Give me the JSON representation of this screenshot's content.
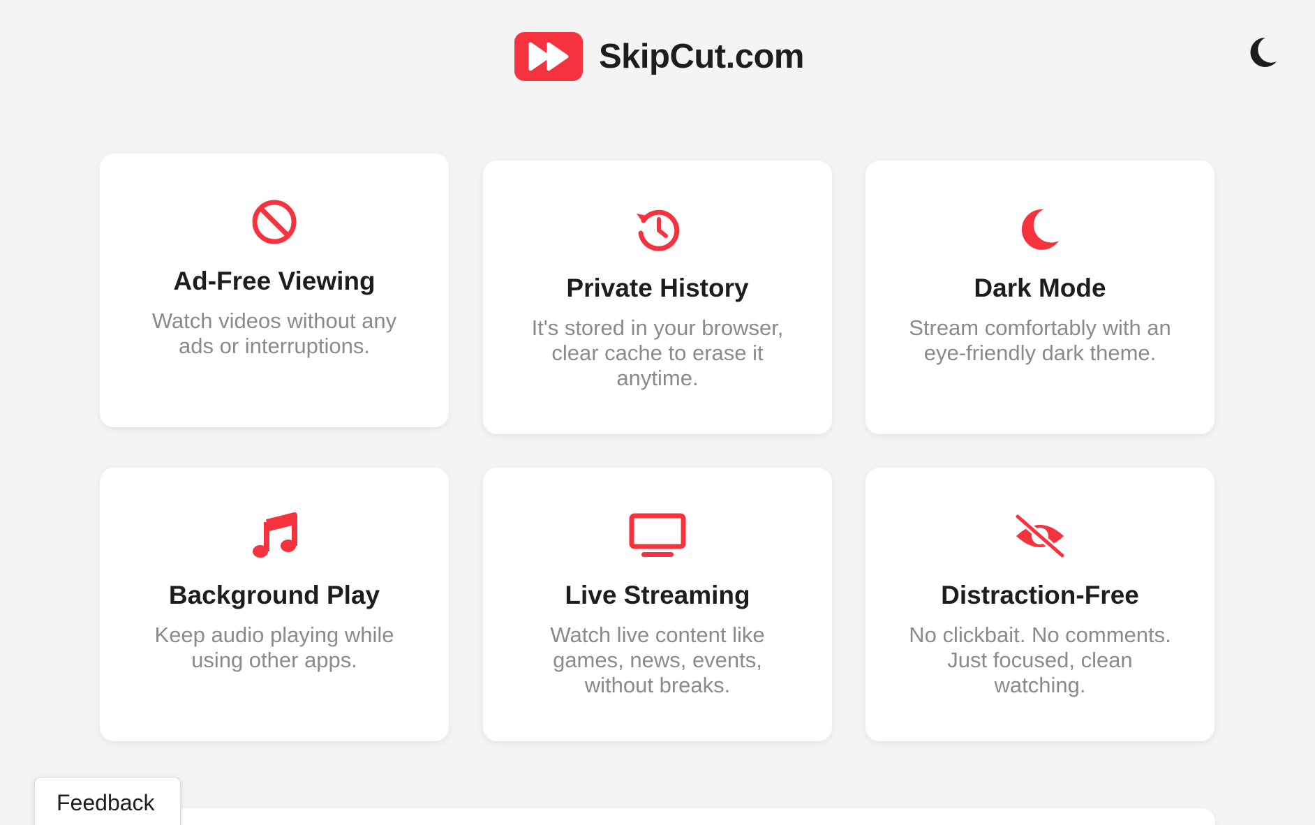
{
  "header": {
    "brand_name": "SkipCut.com",
    "logo_icon": "fast-forward-icon",
    "theme_toggle_icon": "moon-icon"
  },
  "colors": {
    "accent": "#f5333f",
    "background": "#f4f4f6",
    "card": "#ffffff",
    "title_text": "#1d1d1f",
    "body_text": "#8a8a8e"
  },
  "features": [
    {
      "icon": "no-ads-icon",
      "title": "Ad-Free Viewing",
      "description": "Watch videos without any ads or interruptions."
    },
    {
      "icon": "history-icon",
      "title": "Private History",
      "description": "It's stored in your browser, clear cache to erase it anytime."
    },
    {
      "icon": "moon-icon",
      "title": "Dark Mode",
      "description": "Stream comfortably with an eye-friendly dark theme."
    },
    {
      "icon": "music-note-icon",
      "title": "Background Play",
      "description": "Keep audio playing while using other apps."
    },
    {
      "icon": "tv-icon",
      "title": "Live Streaming",
      "description": "Watch live content like games, news, events, without breaks."
    },
    {
      "icon": "eye-slash-icon",
      "title": "Distraction-Free",
      "description": "No clickbait. No comments. Just focused, clean watching."
    }
  ],
  "feedback": {
    "label": "Feedback"
  }
}
